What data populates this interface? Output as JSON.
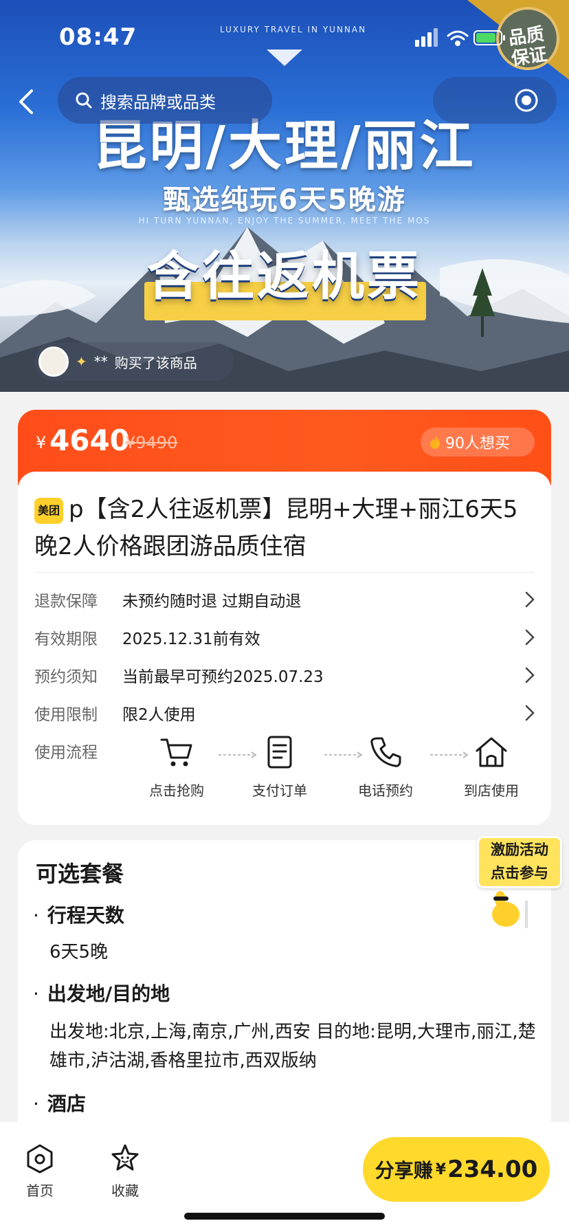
{
  "status_bar": {
    "time": "08:47"
  },
  "hero": {
    "tagline": "LUXURY TRAVEL IN YUNNAN",
    "title_line1": "昆明/大理/丽江",
    "title_line2": "甄选纯玩6天5晚游",
    "title_line3": "HI TURN YUNNAN, ENJOY THE SUMMER, MEET THE MOS",
    "title_line4": "含往返机票",
    "seal_text": "品质保证"
  },
  "search": {
    "placeholder": "搜索品牌或品类"
  },
  "buyer_ticker": {
    "name": "**",
    "text": "购买了该商品"
  },
  "price": {
    "currency": "¥",
    "current": "4640",
    "original": "¥9490",
    "want_count": "90人想买"
  },
  "product": {
    "brand_badge": "美团",
    "title": "p【含2人往返机票】昆明+大理+丽江6天5晚2人价格跟团游品质住宿"
  },
  "info_rows": [
    {
      "label": "退款保障",
      "value": "未预约随时退 过期自动退"
    },
    {
      "label": "有效期限",
      "value": "2025.12.31前有效"
    },
    {
      "label": "预约须知",
      "value": "当前最早可预约2025.07.23"
    },
    {
      "label": "使用限制",
      "value": "限2人使用"
    }
  ],
  "flow": {
    "label": "使用流程",
    "steps": [
      "点击抢购",
      "支付订单",
      "电话预约",
      "到店使用"
    ]
  },
  "package": {
    "title": "可选套餐",
    "sections": [
      {
        "heading": "行程天数",
        "body": "6天5晚"
      },
      {
        "heading": "出发地/目的地",
        "body": "出发地:北京,上海,南京,广州,西安 目的地:昆明,大理市,丽江,楚雄市,泸沽湖,香格里拉市,西双版纳"
      },
      {
        "heading": "酒店",
        "body": ""
      }
    ]
  },
  "promo": {
    "line1": "激励活动",
    "line2": "点击参与"
  },
  "bottom_bar": {
    "home": "首页",
    "favorite": "收藏",
    "share_label": "分享赚",
    "share_currency": "¥",
    "share_amount": "234.00"
  },
  "colors": {
    "accent": "#ff4d1a",
    "share": "#ffd92b",
    "brand": "#ffd02b"
  }
}
